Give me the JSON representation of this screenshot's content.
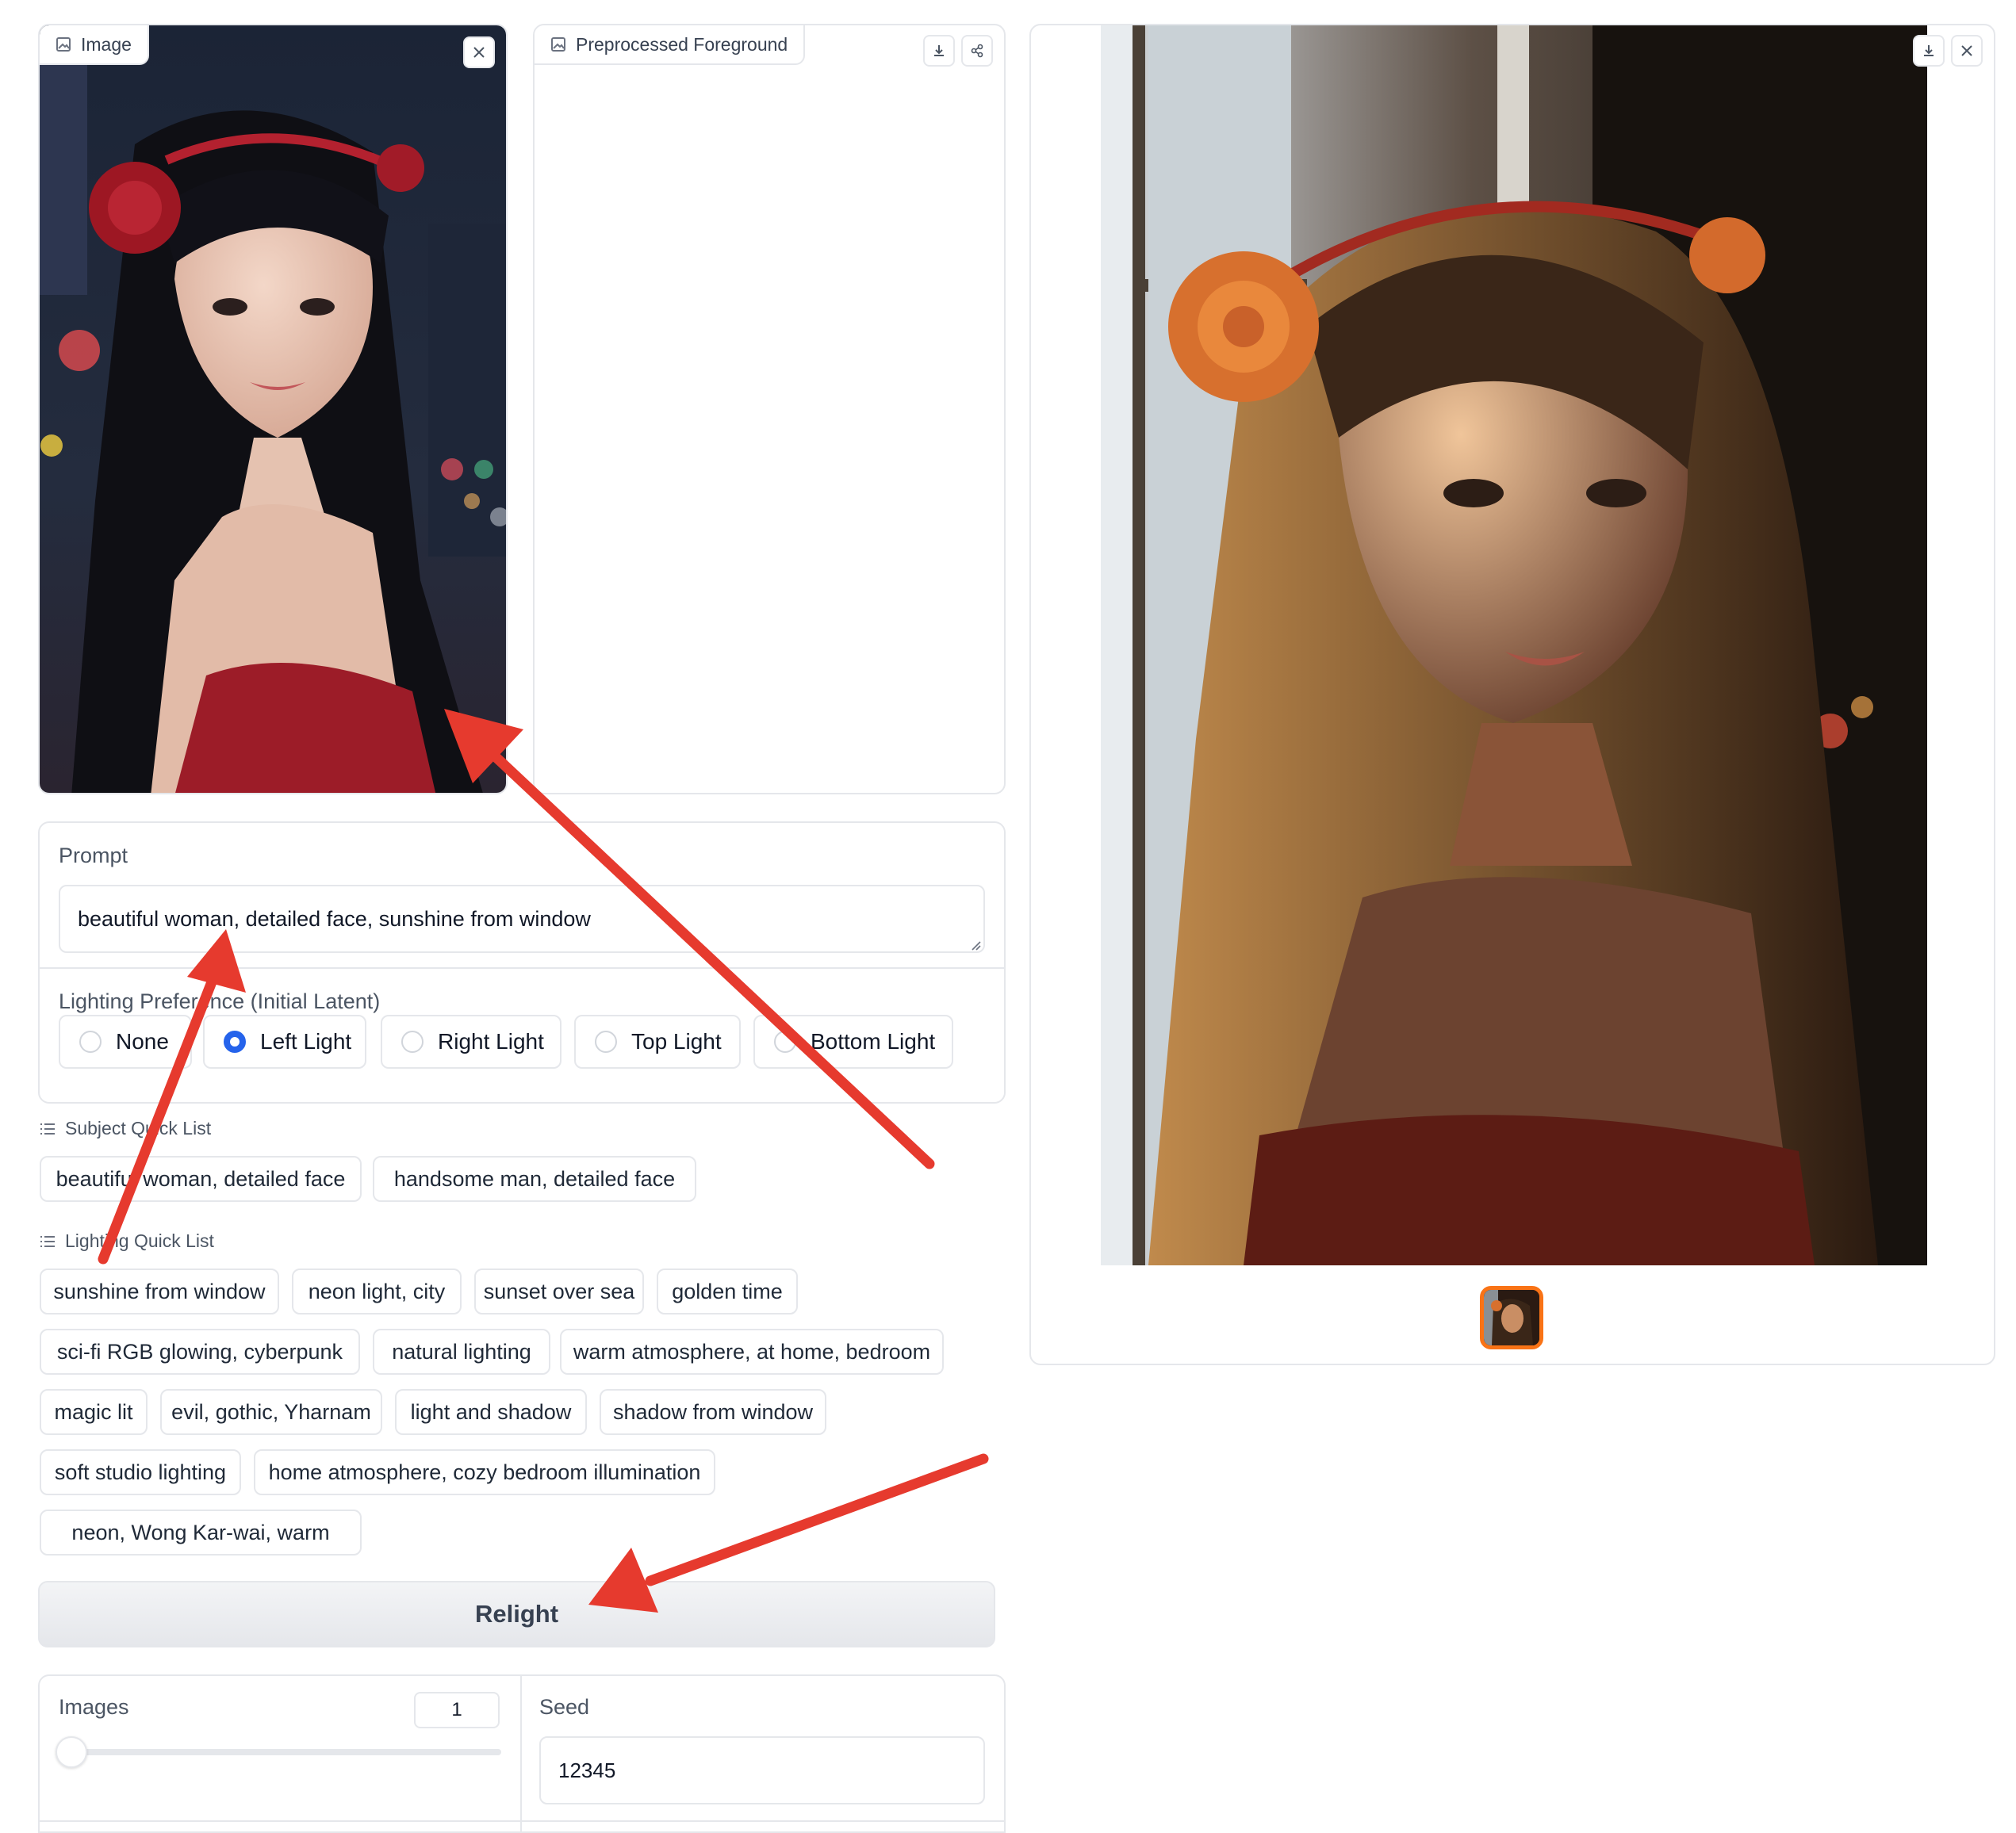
{
  "input_panel": {
    "label": "Image",
    "image_desc_icon": "image-icon"
  },
  "preprocessed_panel": {
    "label": "Preprocessed Foreground"
  },
  "prompt": {
    "label": "Prompt",
    "value": "beautiful woman, detailed face, sunshine from window"
  },
  "lighting_preference": {
    "label": "Lighting Preference (Initial Latent)",
    "options": [
      "None",
      "Left Light",
      "Right Light",
      "Top Light",
      "Bottom Light"
    ],
    "selected": "Left Light"
  },
  "subject_quick_list": {
    "label": "Subject Quick List",
    "items": [
      "beautiful woman, detailed face",
      "handsome man, detailed face"
    ]
  },
  "lighting_quick_list": {
    "label": "Lighting Quick List",
    "items": [
      "sunshine from window",
      "neon light, city",
      "sunset over sea",
      "golden time",
      "sci-fi RGB glowing, cyberpunk",
      "natural lighting",
      "warm atmosphere, at home, bedroom",
      "magic lit",
      "evil, gothic, Yharnam",
      "light and shadow",
      "shadow from window",
      "soft studio lighting",
      "home atmosphere, cozy bedroom illumination",
      "neon, Wong Kar-wai, warm"
    ]
  },
  "relight_button": {
    "label": "Relight"
  },
  "images": {
    "label": "Images",
    "value": "1",
    "level": 0.0
  },
  "seed": {
    "label": "Seed",
    "value": "12345"
  },
  "colors": {
    "accent": "#2563eb",
    "arrow": "#e63a2e",
    "thumb_border": "#f97316"
  }
}
